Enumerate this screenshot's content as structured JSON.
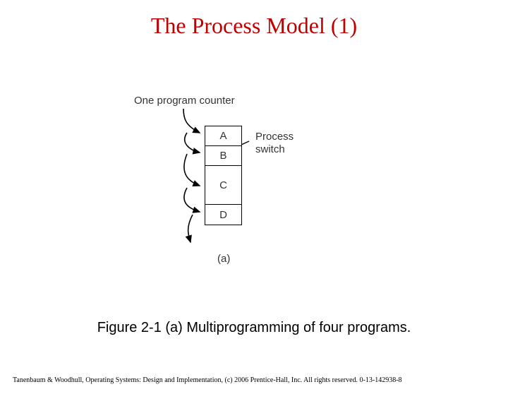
{
  "title": "The Process Model (1)",
  "diagram": {
    "top_label": "One program counter",
    "right_label_line1": "Process",
    "right_label_line2": "switch",
    "cells": {
      "a": "A",
      "b": "B",
      "c": "C",
      "d": "D"
    },
    "sub_label": "(a)"
  },
  "caption": "Figure 2-1 (a) Multiprogramming of four programs.",
  "copyright": "Tanenbaum & Woodhull, Operating Systems: Design and Implementation, (c) 2006 Prentice-Hall, Inc. All rights reserved. 0-13-142938-8"
}
